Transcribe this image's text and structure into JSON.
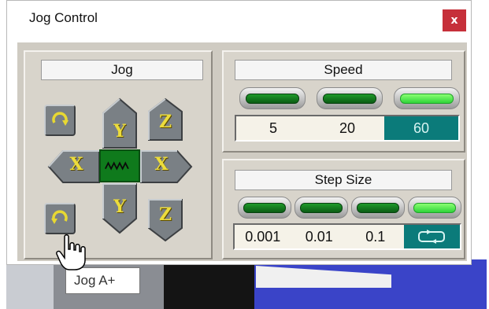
{
  "window": {
    "title": "Jog Control",
    "close_label": "x"
  },
  "jog": {
    "title": "Jog",
    "center_label": "∿∿",
    "buttons": {
      "y_plus": "Y",
      "y_minus": "Y",
      "x_minus": "X",
      "x_plus": "X",
      "z_plus": "Z",
      "z_minus": "Z"
    },
    "icons": [
      "rotate-cw-icon",
      "rotate-ccw-icon",
      "wave-icon"
    ]
  },
  "speed": {
    "title": "Speed",
    "values": [
      "5",
      "20",
      "60"
    ],
    "active_index": 2
  },
  "step_size": {
    "title": "Step Size",
    "values": [
      "0.001",
      "0.01",
      "0.1",
      "↻"
    ],
    "active_index": 3,
    "active_icon": "continuous-icon"
  },
  "tooltip": "Jog A+",
  "colors": {
    "led_off": "#0b5c14",
    "led_on": "#2fd43a",
    "active_cell": "#0b7b7a",
    "jog_label": "#ecdc3c",
    "close": "#c6303a"
  }
}
